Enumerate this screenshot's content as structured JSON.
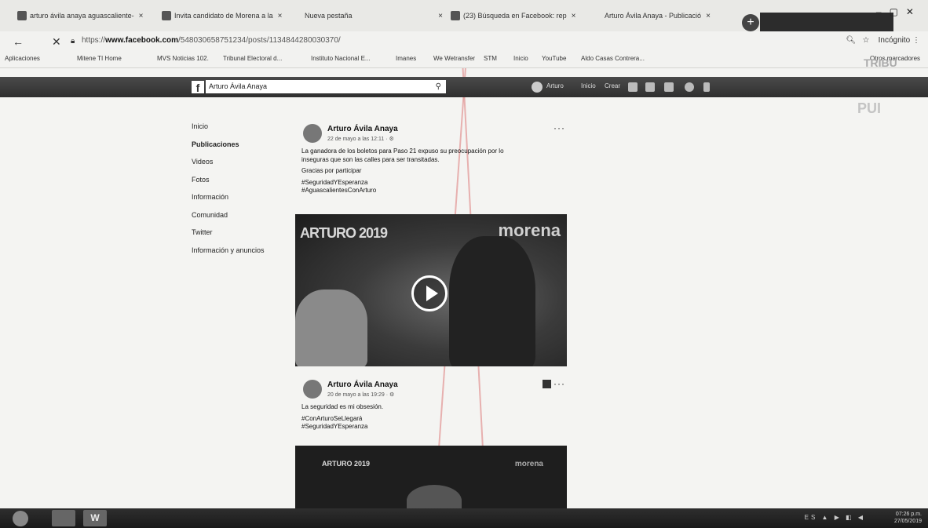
{
  "browser": {
    "tabs": [
      {
        "label": "arturo ávila anaya aguascaliente-",
        "close": "×"
      },
      {
        "label": "Invita candidato de Morena a la",
        "close": "×"
      },
      {
        "label": "Nueva pestaña",
        "close": "×"
      },
      {
        "label": "(23) Búsqueda en Facebook: rep",
        "close": "×"
      },
      {
        "label": "Arturo Ávila Anaya - Publicació",
        "close": "×"
      }
    ],
    "new_tab": "+",
    "url_prefix": "https://",
    "url_domain": "www.facebook.com",
    "url_path": "/548030658751234/posts/1134844280030370/",
    "profile_text": "Incógnito",
    "bookmarks": [
      "Aplicaciones",
      "Mitene TI Home",
      "MVS Noticias 102.",
      "Tribunal Electoral d...",
      "Instituto Nacional E...",
      "Imanes",
      "We Wetransfer",
      "STM",
      "Inicio",
      "YouTube",
      "Aldo Casas Contrera..."
    ],
    "bookmarks_right": "Otros marcadores"
  },
  "facebook": {
    "search_value": "Arturo Ávila Anaya",
    "nav": [
      "Arturo",
      "Inicio",
      "Crear"
    ]
  },
  "watermark": {
    "tribu": "TRIBU",
    "pub": "PUI"
  },
  "leftmenu": {
    "items": [
      "Inicio",
      "Publicaciones",
      "Videos",
      "Fotos",
      "Información",
      "Comunidad",
      "Twitter",
      "Información y anuncios"
    ]
  },
  "posts": [
    {
      "author": "Arturo Ávila Anaya",
      "date": "22 de mayo a las 12:11 · ⚙",
      "more": "···",
      "lines": [
        "La ganadora de los boletos para Paso 21 expuso su preocupación por lo",
        "inseguras que son las calles para ser transitadas.",
        "Gracias por participar",
        "#SeguridadYEsperanza",
        "#AguascalientesConArturo"
      ],
      "video_left": "ARTURO 2019",
      "video_right": "morena"
    },
    {
      "author": "Arturo Ávila Anaya",
      "date": "20 de mayo a las 19:29 · ⚙",
      "more": "···",
      "lines": [
        "La seguridad es mi obsesión.",
        "#ConArturoSeLlegará",
        "#SeguridadYEsperanza"
      ],
      "video_left": "ARTURO 2019",
      "video_right": "morena"
    }
  ],
  "taskbar": {
    "app": "W",
    "tray": "ES ▲ ▶ ◧ ◀",
    "time": "07:26 p.m.",
    "date": "27/05/2019"
  }
}
